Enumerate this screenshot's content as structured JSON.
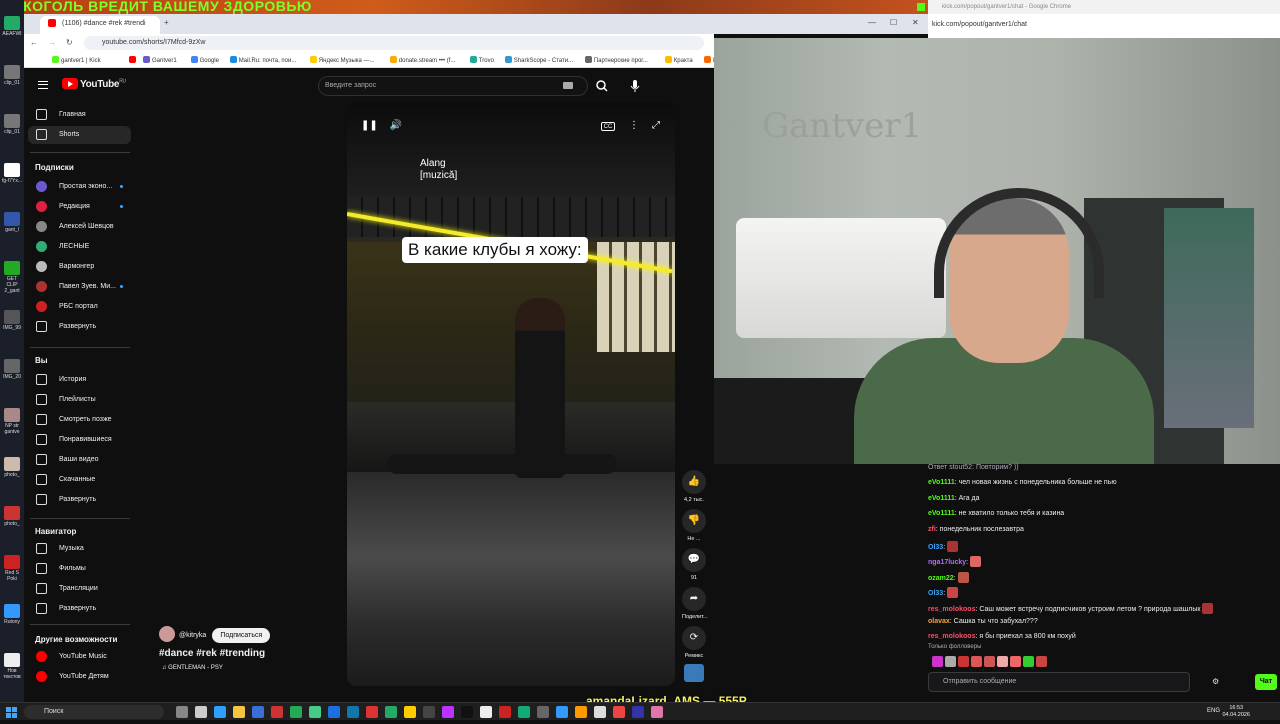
{
  "banner": {
    "text": "АЛКОГОЛЬ ВРЕДИТ ВАШЕМУ ЗДОРОВЬЮ"
  },
  "desktop_icons": [
    "AEAFWI",
    "clip_01",
    "clip_01",
    "fg-f7Yx...",
    "gant_l",
    "GET CLIP 2_gant",
    "IMG_99",
    "IMG_20",
    "NP str gantve",
    "photo_",
    "photo_",
    "Red S Poki",
    "Rutony",
    "Нов текстов"
  ],
  "chrome": {
    "tab_title": "(1106) #dance #rek #trendi",
    "url": "youtube.com/shorts/I7Mfcd-9zXw",
    "bookmarks": [
      "gantver1 | Kick",
      "",
      "Gantver1",
      "Google",
      "Mail.Ru: почта, пои...",
      "Яндекс Музыка —...",
      "donate.stream ••• (f...",
      "Trovo",
      "SharkScope - Стати...",
      "Партнерские прог...",
      "Кракта",
      "Bitly | URL Sh"
    ]
  },
  "youtube": {
    "logo": "YouTube",
    "logo_region": "RU",
    "search_placeholder": "Введите запрос",
    "nav_main": [
      {
        "label": "Главная"
      },
      {
        "label": "Shorts"
      }
    ],
    "subs_header": "Подписки",
    "subscriptions": [
      {
        "label": "Простая эконо...",
        "color": "#6a5acd",
        "dot": true
      },
      {
        "label": "Редакция",
        "color": "#e02040",
        "dot": true
      },
      {
        "label": "Алексей Шевцов",
        "color": "#888",
        "dot": false
      },
      {
        "label": "ЛЕСНЫЕ",
        "color": "#3a7",
        "dot": false
      },
      {
        "label": "Вармонгер",
        "color": "#bbb",
        "dot": false
      },
      {
        "label": "Павел Зуев. Ми...",
        "color": "#a33",
        "dot": true
      },
      {
        "label": "РБС портал",
        "color": "#c22",
        "dot": false
      },
      {
        "label": "Развернуть",
        "color": "",
        "dot": false
      }
    ],
    "you_header": "Вы",
    "you_items": [
      "История",
      "Плейлисты",
      "Смотреть позже",
      "Понравившиеся",
      "Ваши видео",
      "Скачанные",
      "Развернуть"
    ],
    "nav_header": "Навигатор",
    "nav_items": [
      "Музыка",
      "Фильмы",
      "Трансляции",
      "Развернуть"
    ],
    "more_header": "Другие возможности",
    "more_items": [
      "YouTube Music",
      "YouTube Детям"
    ],
    "video": {
      "music_line1": "Alang",
      "music_line2": "[muzică]",
      "caption": "В какие клубы я хожу:",
      "channel": "@kitryka",
      "subscribe": "Подписаться",
      "tags": "#dance #rek #trending",
      "song": "♫ GENTLEMAN - PSY"
    },
    "actions": [
      {
        "icon": "like-icon",
        "glyph": "👍",
        "label": "4,2 тыс."
      },
      {
        "icon": "dislike-icon",
        "glyph": "👎",
        "label": "Не ..."
      },
      {
        "icon": "comment-icon",
        "glyph": "💬",
        "label": "91"
      },
      {
        "icon": "share-icon",
        "glyph": "➦",
        "label": "Поделит..."
      },
      {
        "icon": "remix-icon",
        "glyph": "⟳",
        "label": "Ремикс"
      }
    ]
  },
  "popout": {
    "title": "kick.com/popout/gantver1/chat - Google Chrome",
    "url": "kick.com/popout/gantver1/chat"
  },
  "webcam": {
    "wall_text": "Gantver1"
  },
  "chat": {
    "messages": [
      {
        "user": "",
        "color": "#adadb8",
        "text": "Ответ stout52: Повторим? ))"
      },
      {
        "user": "eVo1111",
        "color": "#53fc18",
        "text": ": чел новая жизнь с понедельника больше не пью"
      },
      {
        "user": "eVo1111",
        "color": "#53fc18",
        "text": ": Ага да"
      },
      {
        "user": "eVo1111",
        "color": "#53fc18",
        "text": ": не хватило только тебя и казина"
      },
      {
        "user": "zfi",
        "color": "#ff4d6d",
        "text": ": понедельник послезавтра"
      },
      {
        "user": "Ol33",
        "color": "#3ea6ff",
        "text": ":"
      },
      {
        "user": "nga17lucky",
        "color": "#b06cff",
        "text": ":"
      },
      {
        "user": "ozam22",
        "color": "#53fc18",
        "text": ":"
      },
      {
        "user": "Ol33",
        "color": "#3ea6ff",
        "text": ":"
      },
      {
        "user": "res_molokoos",
        "color": "#ff4d6d",
        "text": ": Саш может встречу подписчиков устроим летом ? природа шашлык"
      },
      {
        "user": "olavax",
        "color": "#f7a23e",
        "text": ": Сашка ты что забухал???"
      },
      {
        "user": "res_molokoos",
        "color": "#ff4d6d",
        "text": ": я бы приехал за 800 км похуй"
      }
    ],
    "followers_label": "Только фолловеры",
    "input_placeholder": "Отправить сообщение",
    "send": "Чат"
  },
  "overlay": {
    "donate": "amandaLizard_AMS — 555P"
  },
  "taskbar": {
    "search": "Поиск",
    "lang": "ENG",
    "time": "16:53",
    "date": "04.04.2026"
  }
}
